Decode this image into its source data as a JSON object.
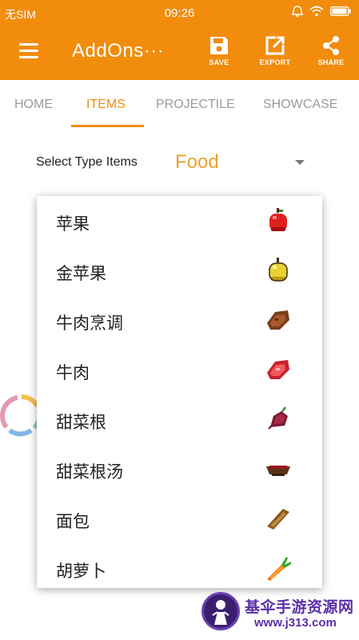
{
  "status_bar": {
    "carrier": "无SIM",
    "time": "09:26",
    "icons": [
      "alarm-icon",
      "wifi-icon",
      "battery-icon"
    ]
  },
  "app_bar": {
    "title": "AddOns···",
    "actions": [
      {
        "label": "SAVE",
        "icon": "save-icon"
      },
      {
        "label": "EXPORT",
        "icon": "export-icon"
      },
      {
        "label": "SHARE",
        "icon": "share-icon"
      }
    ]
  },
  "tabs": [
    {
      "label": "HOME"
    },
    {
      "label": "ITEMS",
      "active": true
    },
    {
      "label": "PROJECTILE"
    },
    {
      "label": "SHOWCASE"
    }
  ],
  "type_selector": {
    "label": "Select Type Items",
    "value": "Food"
  },
  "dropdown_options": [
    {
      "label": "苹果",
      "icon": "apple-icon"
    },
    {
      "label": "金苹果",
      "icon": "golden-apple-icon"
    },
    {
      "label": "牛肉烹调",
      "icon": "cooked-beef-icon"
    },
    {
      "label": "牛肉",
      "icon": "raw-beef-icon"
    },
    {
      "label": "甜菜根",
      "icon": "beetroot-icon"
    },
    {
      "label": "甜菜根汤",
      "icon": "beetroot-soup-icon"
    },
    {
      "label": "面包",
      "icon": "bread-icon"
    },
    {
      "label": "胡萝卜",
      "icon": "carrot-icon"
    }
  ],
  "watermark": {
    "name": "基伞手游资源网",
    "url": "www.j313.com"
  },
  "colors": {
    "primary": "#f28c0c",
    "value_text": "#e9a22f",
    "tab_inactive": "#9b9b9b"
  }
}
